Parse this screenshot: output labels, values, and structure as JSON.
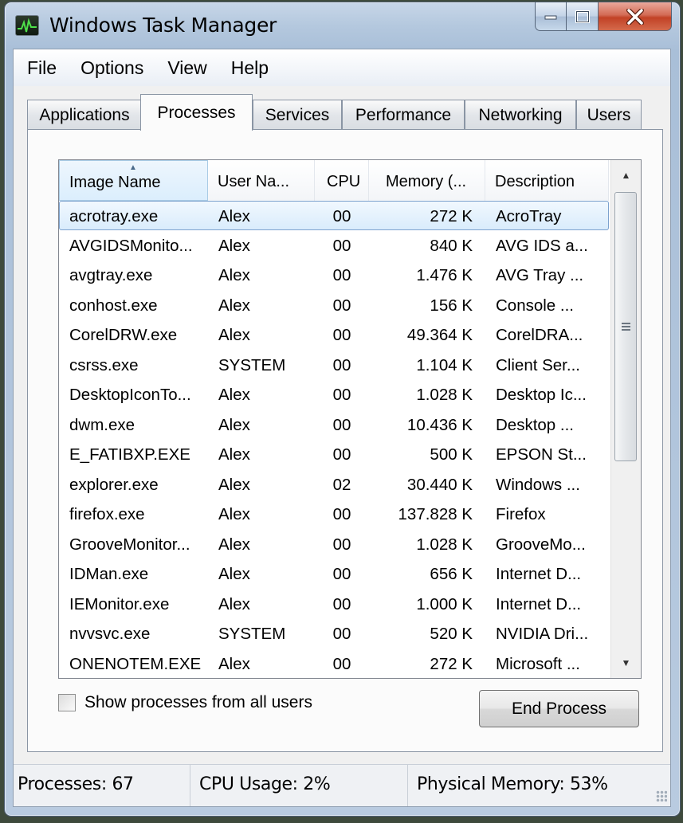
{
  "window": {
    "title": "Windows Task Manager"
  },
  "menu": [
    "File",
    "Options",
    "View",
    "Help"
  ],
  "tabs": [
    "Applications",
    "Processes",
    "Services",
    "Performance",
    "Networking",
    "Users"
  ],
  "active_tab": "Processes",
  "columns": [
    "Image Name",
    "User Na...",
    "CPU",
    "Memory (...",
    "Description"
  ],
  "sorted_column": "Image Name",
  "processes": [
    {
      "name": "acrotray.exe",
      "user": "Alex",
      "cpu": "00",
      "memory": "272 K",
      "description": "AcroTray",
      "selected": true
    },
    {
      "name": "AVGIDSMonito...",
      "user": "Alex",
      "cpu": "00",
      "memory": "840 K",
      "description": "AVG IDS a..."
    },
    {
      "name": "avgtray.exe",
      "user": "Alex",
      "cpu": "00",
      "memory": "1.476 K",
      "description": "AVG Tray ..."
    },
    {
      "name": "conhost.exe",
      "user": "Alex",
      "cpu": "00",
      "memory": "156 K",
      "description": "Console ..."
    },
    {
      "name": "CorelDRW.exe",
      "user": "Alex",
      "cpu": "00",
      "memory": "49.364 K",
      "description": "CorelDRA..."
    },
    {
      "name": "csrss.exe",
      "user": "SYSTEM",
      "cpu": "00",
      "memory": "1.104 K",
      "description": "Client Ser..."
    },
    {
      "name": "DesktopIconTo...",
      "user": "Alex",
      "cpu": "00",
      "memory": "1.028 K",
      "description": "Desktop Ic..."
    },
    {
      "name": "dwm.exe",
      "user": "Alex",
      "cpu": "00",
      "memory": "10.436 K",
      "description": "Desktop ..."
    },
    {
      "name": "E_FATIBXP.EXE",
      "user": "Alex",
      "cpu": "00",
      "memory": "500 K",
      "description": "EPSON St..."
    },
    {
      "name": "explorer.exe",
      "user": "Alex",
      "cpu": "02",
      "memory": "30.440 K",
      "description": "Windows ..."
    },
    {
      "name": "firefox.exe",
      "user": "Alex",
      "cpu": "00",
      "memory": "137.828 K",
      "description": "Firefox"
    },
    {
      "name": "GrooveMonitor...",
      "user": "Alex",
      "cpu": "00",
      "memory": "1.028 K",
      "description": "GrooveMo..."
    },
    {
      "name": "IDMan.exe",
      "user": "Alex",
      "cpu": "00",
      "memory": "656 K",
      "description": "Internet D..."
    },
    {
      "name": "IEMonitor.exe",
      "user": "Alex",
      "cpu": "00",
      "memory": "1.000 K",
      "description": "Internet D..."
    },
    {
      "name": "nvvsvc.exe",
      "user": "SYSTEM",
      "cpu": "00",
      "memory": "520 K",
      "description": "NVIDIA Dri..."
    },
    {
      "name": "ONENOTEM.EXE",
      "user": "Alex",
      "cpu": "00",
      "memory": "272 K",
      "description": "Microsoft ..."
    }
  ],
  "show_all_users": {
    "label": "Show processes from all users",
    "checked": false
  },
  "end_process_label": "End Process",
  "status": {
    "processes": "Processes: 67",
    "cpu_usage": "CPU Usage: 2%",
    "physical_memory": "Physical Memory: 53%"
  },
  "icons": {
    "app": "task-manager-icon",
    "minimize": "minimize-icon",
    "maximize": "maximize-icon",
    "close": "close-icon",
    "sort": "sort-ascending-icon",
    "scroll_up": "scroll-up-icon",
    "scroll_down": "scroll-down-icon"
  }
}
